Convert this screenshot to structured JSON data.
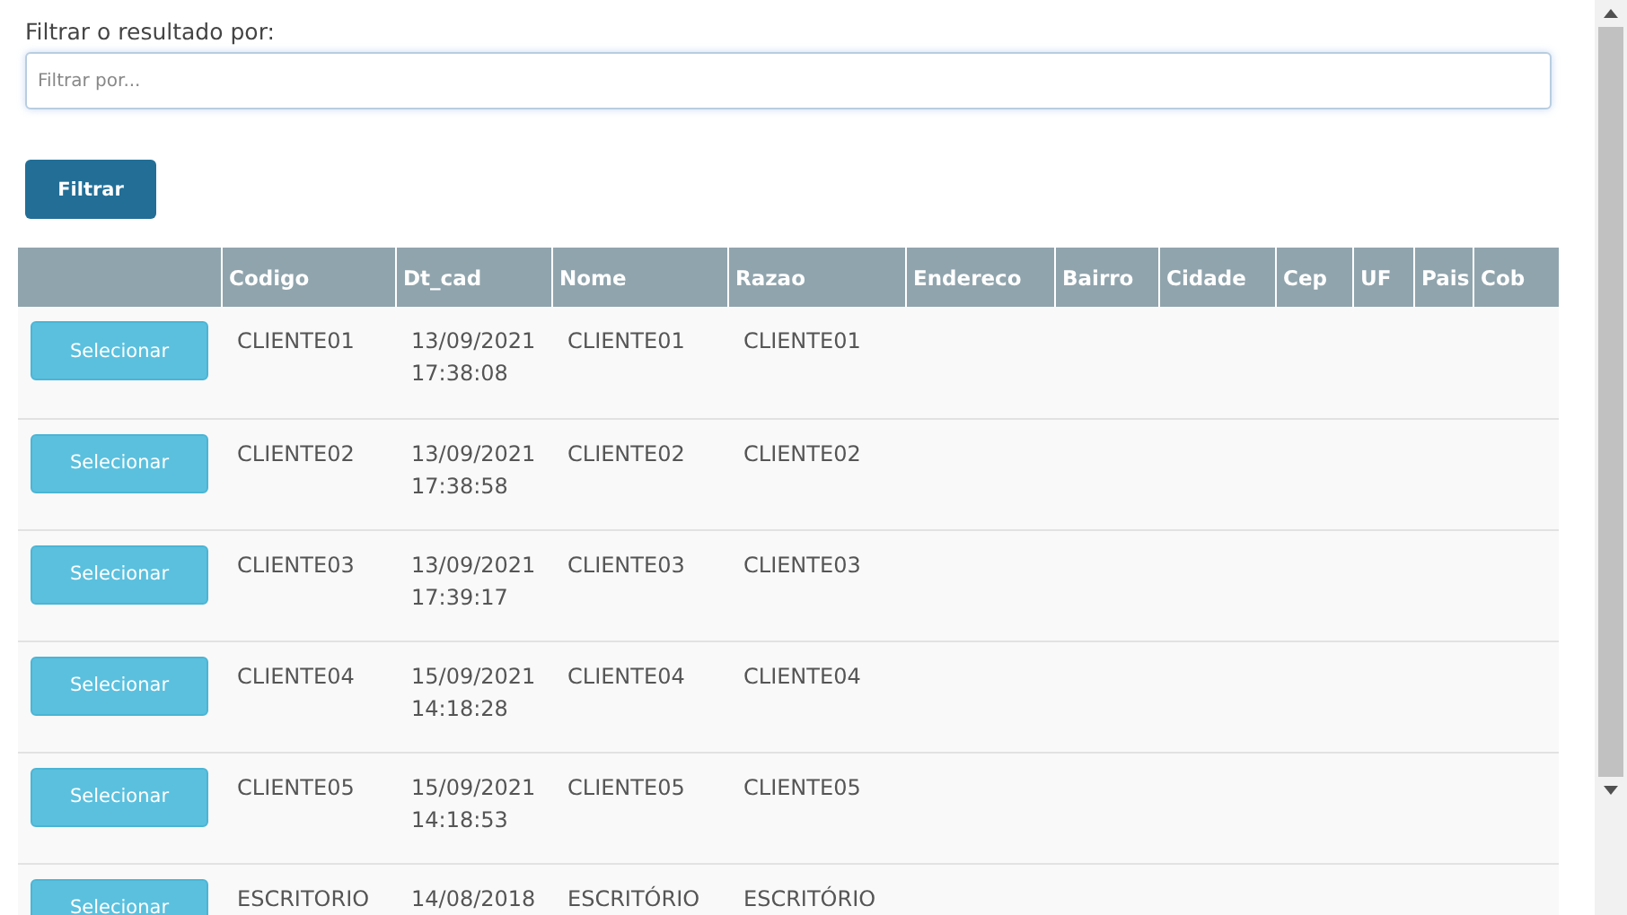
{
  "filter": {
    "label": "Filtrar o resultado por:",
    "placeholder": "Filtrar por...",
    "button": "Filtrar"
  },
  "table": {
    "columns": [
      "",
      "Codigo",
      "Dt_cad",
      "Nome",
      "Razao",
      "Endereco",
      "Bairro",
      "Cidade",
      "Cep",
      "UF",
      "Pais",
      "Cob"
    ],
    "rows": [
      {
        "action": "Selecionar",
        "codigo": "CLIENTE01",
        "dt_cad": "13/09/2021 17:38:08",
        "nome": "CLIENTE01",
        "razao": "CLIENTE01"
      },
      {
        "action": "Selecionar",
        "codigo": "CLIENTE02",
        "dt_cad": "13/09/2021 17:38:58",
        "nome": "CLIENTE02",
        "razao": "CLIENTE02"
      },
      {
        "action": "Selecionar",
        "codigo": "CLIENTE03",
        "dt_cad": "13/09/2021 17:39:17",
        "nome": "CLIENTE03",
        "razao": "CLIENTE03"
      },
      {
        "action": "Selecionar",
        "codigo": "CLIENTE04",
        "dt_cad": "15/09/2021 14:18:28",
        "nome": "CLIENTE04",
        "razao": "CLIENTE04"
      },
      {
        "action": "Selecionar",
        "codigo": "CLIENTE05",
        "dt_cad": "15/09/2021 14:18:53",
        "nome": "CLIENTE05",
        "razao": "CLIENTE05"
      },
      {
        "action": "Selecionar",
        "codigo": "ESCRITORIO",
        "dt_cad": "14/08/2018",
        "nome": "ESCRITÓRIO",
        "razao": "ESCRITÓRIO"
      }
    ]
  }
}
